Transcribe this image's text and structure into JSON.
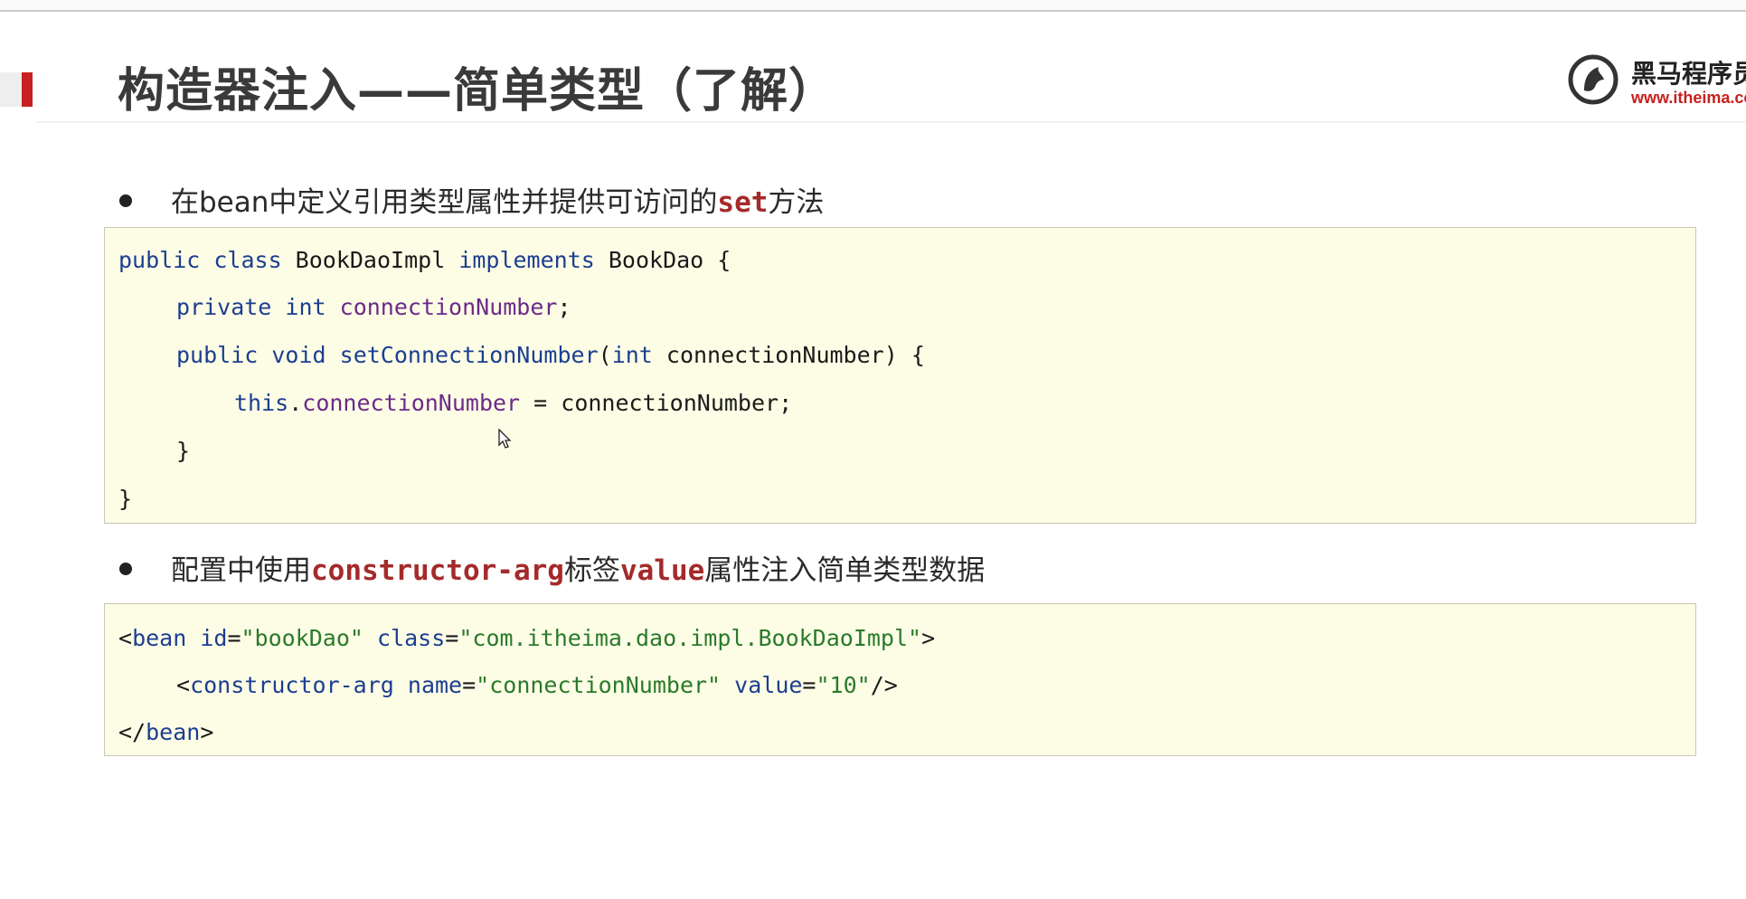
{
  "title": "构造器注入——简单类型（了解）",
  "logo": {
    "name": "黑马程序员",
    "url": "www.itheima.com",
    "brand_color": "#c8201e"
  },
  "bullet1": {
    "prefix": "在bean中定义引用类型属性并提供可访问的",
    "keyword": "set",
    "suffix": "方法"
  },
  "java_code": {
    "l1": {
      "a": "public class",
      "b": " BookDaoImpl ",
      "c": "implements",
      "d": " BookDao {"
    },
    "l2": {
      "a": "private int",
      "b": " ",
      "c": "connectionNumber",
      "d": ";"
    },
    "l3": {
      "a": "public void",
      "b": " ",
      "c": "setConnectionNumber",
      "d": "(",
      "e": "int",
      "f": " connectionNumber) {"
    },
    "l4": {
      "a": "this",
      "b": ".",
      "c": "connectionNumber",
      "d": " = connectionNumber;"
    },
    "l5": "}",
    "l6": "}"
  },
  "bullet2": {
    "prefix": "配置中使用",
    "keyword1": "constructor-arg",
    "middle": "标签",
    "keyword2": "value",
    "suffix": "属性注入简单类型数据"
  },
  "xml_code": {
    "l1": {
      "a": "<",
      "b": "bean",
      "c": " id",
      "d": "=",
      "e": "\"bookDao\"",
      "f": " class",
      "g": "=",
      "h": "\"com.itheima.dao.impl.BookDaoImpl\"",
      "i": ">"
    },
    "l2": {
      "a": "<",
      "b": "constructor-arg",
      "c": " name",
      "d": "=",
      "e": "\"connectionNumber\"",
      "f": " value",
      "g": "=",
      "h": "\"10\"",
      "i": "/>"
    },
    "l3": {
      "a": "</",
      "b": "bean",
      "c": ">"
    }
  }
}
